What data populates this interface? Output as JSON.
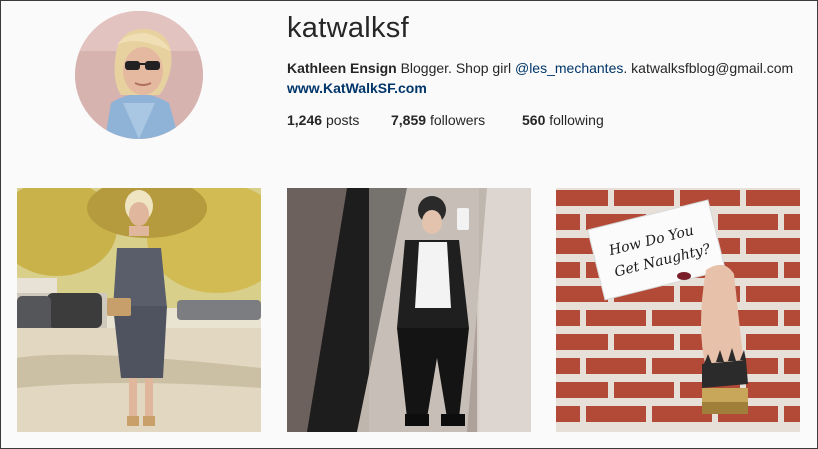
{
  "profile": {
    "username": "katwalksf",
    "full_name": "Kathleen Ensign",
    "bio_part1": " Blogger. Shop girl ",
    "mention": "@les_mechantes",
    "bio_part2": ". katwalksfblog@gmail.com",
    "website": "www.KatWalkSF.com"
  },
  "stats": {
    "posts_count": "1,246",
    "posts_label": "posts",
    "followers_count": "7,859",
    "followers_label": "followers",
    "following_count": "560",
    "following_label": "following"
  },
  "posts": [
    {
      "kind": "photo",
      "subject": "woman in slip dress on street"
    },
    {
      "kind": "photo",
      "subject": "mirror selfie in black outfit"
    },
    {
      "kind": "photo",
      "subject": "hand holding card on brick wall",
      "card_text_line1": "How Do You",
      "card_text_line2": "Get Naughty?"
    }
  ],
  "colors": {
    "link": "#003569",
    "text": "#262626",
    "background": "#fafafa"
  }
}
